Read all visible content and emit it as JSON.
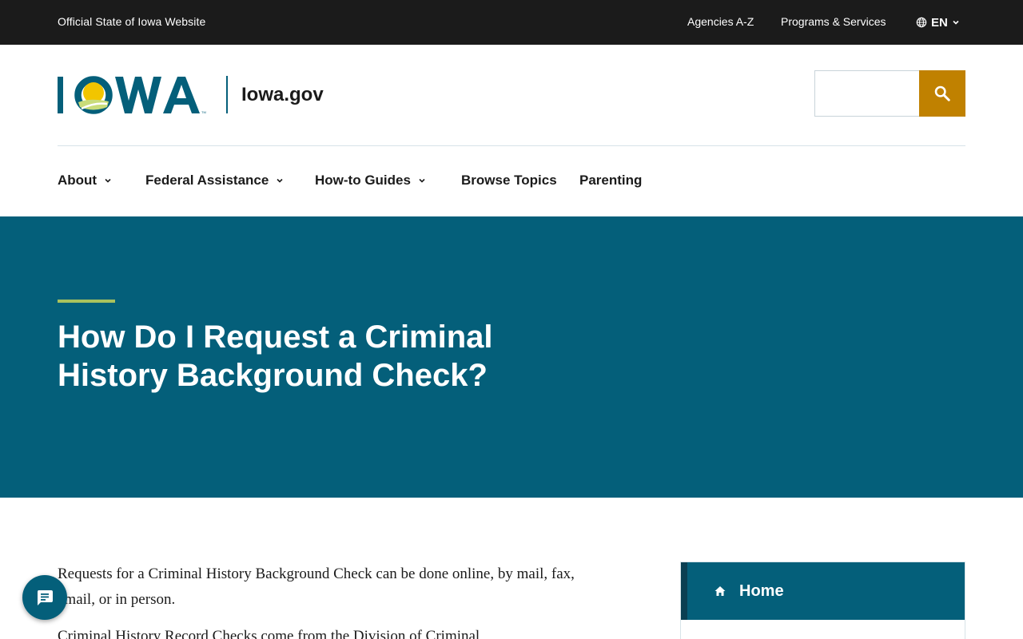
{
  "topbar": {
    "official_text": "Official State of Iowa Website",
    "agencies_label": "Agencies A-Z",
    "programs_label": "Programs & Services",
    "language_label": "EN",
    "language_icon": "globe-icon"
  },
  "header": {
    "logo_text": "IOWA",
    "site_name": "Iowa.gov",
    "search": {
      "placeholder": "",
      "value": "",
      "button_icon": "search-icon"
    }
  },
  "nav": {
    "items": [
      {
        "label": "About",
        "has_dropdown": true
      },
      {
        "label": "Federal Assistance",
        "has_dropdown": true
      },
      {
        "label": "How-to Guides",
        "has_dropdown": true
      },
      {
        "label": "Browse Topics",
        "has_dropdown": false
      },
      {
        "label": "Parenting",
        "has_dropdown": false
      }
    ]
  },
  "hero": {
    "title": "How Do I Request a Criminal History Background Check?"
  },
  "content": {
    "paragraphs": [
      "Requests for a Criminal History Background Check can be done online, by mail, fax, email, or in person.",
      "Criminal History Record Checks come from the Division of Criminal"
    ]
  },
  "sidenav": {
    "home_label": "Home",
    "home_icon": "home-icon"
  },
  "chat": {
    "icon": "chat-icon"
  },
  "colors": {
    "topbar_bg": "#1b1b1b",
    "brand_teal": "#045f7a",
    "accent_gold": "#c08100",
    "accent_green": "#a9c25d"
  }
}
